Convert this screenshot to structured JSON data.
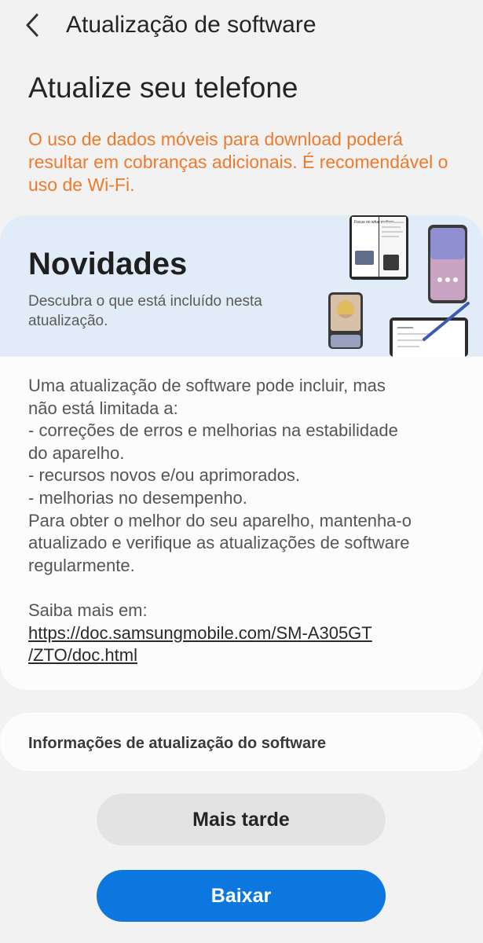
{
  "app_bar": {
    "title": "Atualização de software",
    "back_icon": "chevron-left-icon"
  },
  "heading": "Atualize seu telefone",
  "warning": "O uso de dados móveis para download poderá resultar em cobranças adicionais. É recomendável o uso de Wi-Fi.",
  "whats_new": {
    "title": "Novidades",
    "subtitle": "Descubra o que está incluído nesta atualização.",
    "device_screen_text": "Focus on what matters",
    "body_lines": [
      "Uma atualização de software pode incluir, mas",
      "não está limitada a:",
      " - correções de erros e melhorias na estabilidade",
      "do aparelho.",
      " - recursos novos e/ou aprimorados.",
      " - melhorias no desempenho.",
      "Para obter o melhor do seu aparelho, mantenha-o",
      "atualizado e verifique as atualizações de software",
      "regularmente."
    ],
    "learn_more_label": "Saiba mais em:",
    "link_line1": "https://doc.samsungmobile.com/SM-A305GT",
    "link_line2": "/ZTO/doc.html"
  },
  "info_row": {
    "label": "Informações de atualização do software"
  },
  "buttons": {
    "later": "Mais tarde",
    "download": "Baixar"
  },
  "colors": {
    "background": "#f2f2f2",
    "warning": "#ef7a2b",
    "banner": "#e2ecf8",
    "primary_button": "#0d77e0",
    "secondary_button": "#e3e3e3"
  }
}
